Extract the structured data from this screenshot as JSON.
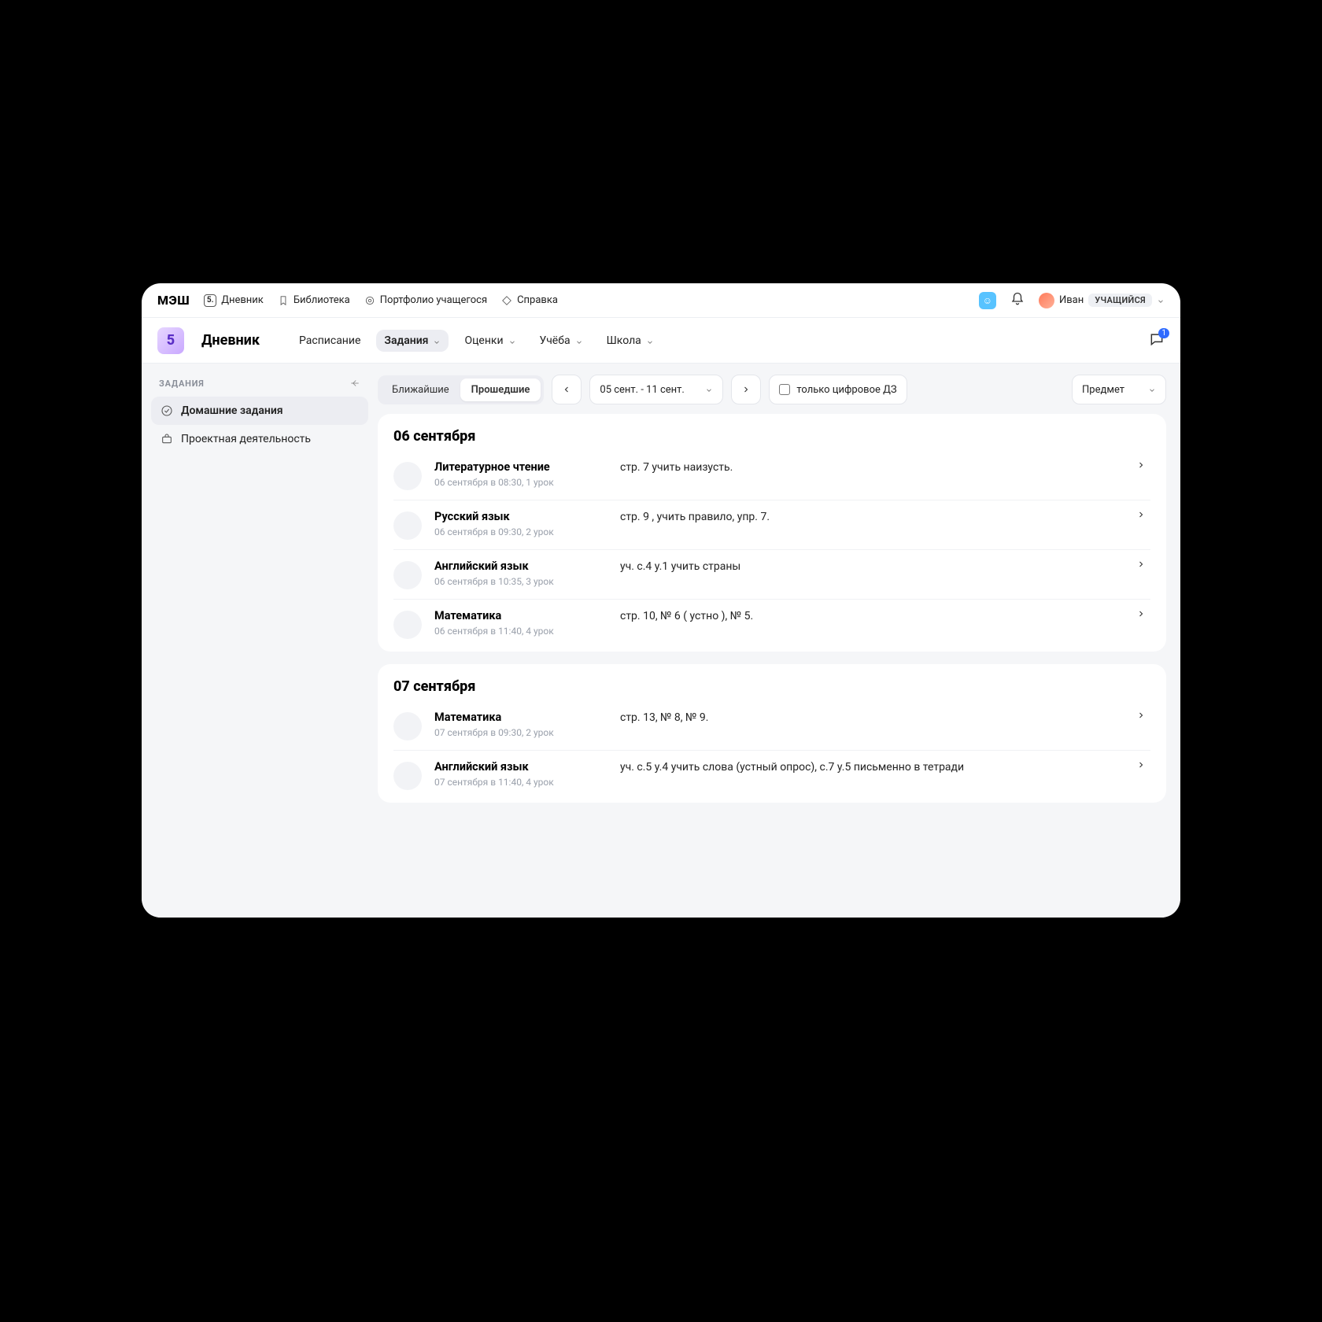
{
  "topnav": {
    "logo": "МЭШ",
    "badge5": "5.",
    "items": [
      "Дневник",
      "Библиотека",
      "Портфолио учащегося",
      "Справка"
    ],
    "user_name": "Иван",
    "role": "УЧАЩИЙСЯ"
  },
  "subheader": {
    "brand_digit": "5",
    "title": "Дневник",
    "tabs": [
      "Расписание",
      "Задания",
      "Оценки",
      "Учёба",
      "Школа"
    ],
    "active_tab": "Задания",
    "notif_count": "1"
  },
  "sidebar": {
    "title": "ЗАДАНИЯ",
    "items": [
      {
        "label": "Домашние задания",
        "active": true
      },
      {
        "label": "Проектная деятельность",
        "active": false
      }
    ]
  },
  "filters": {
    "seg": [
      "Ближайшие",
      "Прошедшие"
    ],
    "seg_active": "Прошедшие",
    "date_range": "05 сент. - 11 сент.",
    "digital_only": "только цифровое ДЗ",
    "subject": "Предмет"
  },
  "groups": [
    {
      "heading": "06 сентября",
      "rows": [
        {
          "subject": "Литературное чтение",
          "meta": "06 сентября в 08:30, 1 урок",
          "text": "стр. 7 учить наизусть."
        },
        {
          "subject": "Русский язык",
          "meta": "06 сентября в 09:30, 2 урок",
          "text": "стр. 9 , учить правило, упр. 7."
        },
        {
          "subject": "Английский язык",
          "meta": "06 сентября в 10:35, 3 урок",
          "text": "уч. с.4 у.1 учить страны"
        },
        {
          "subject": "Математика",
          "meta": "06 сентября в 11:40, 4 урок",
          "text": "стр. 10, № 6 ( устно ), № 5."
        }
      ]
    },
    {
      "heading": "07 сентября",
      "rows": [
        {
          "subject": "Математика",
          "meta": "07 сентября в 09:30, 2 урок",
          "text": "стр. 13, № 8, № 9."
        },
        {
          "subject": "Английский язык",
          "meta": "07 сентября в 11:40, 4 урок",
          "text": "уч. с.5 у.4 учить слова (устный опрос), с.7 у.5 письменно в тетради"
        }
      ]
    }
  ]
}
